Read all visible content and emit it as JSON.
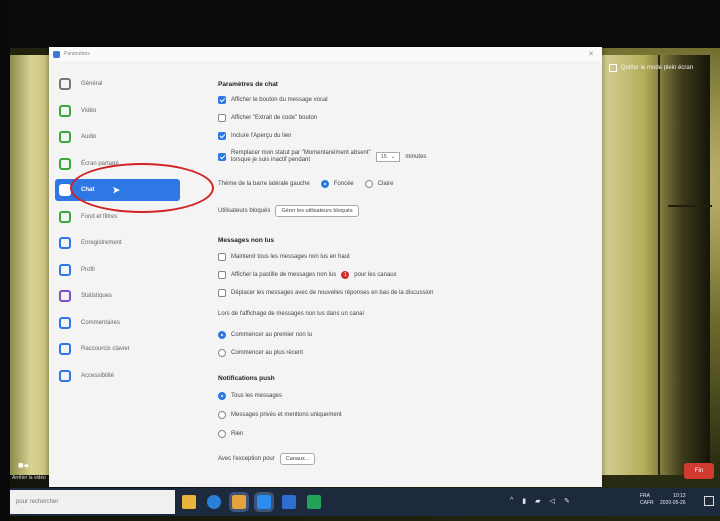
{
  "window": {
    "title": "Paramètres"
  },
  "fullscreen_exit": "Quitter le mode plein écran",
  "video_label": "Arrêter la vidéo",
  "end_button": "Fin",
  "sidebar": {
    "items": [
      {
        "label": "Général",
        "color": "#777777"
      },
      {
        "label": "Vidéo",
        "color": "#3aa83a"
      },
      {
        "label": "Audio",
        "color": "#3aa83a"
      },
      {
        "label": "Écran partagé",
        "color": "#3aa83a"
      },
      {
        "label": "Chat",
        "color": "#2d78e4",
        "active": true
      },
      {
        "label": "Fond et filtres",
        "color": "#3aa83a"
      },
      {
        "label": "Enregistrement",
        "color": "#2d78e4"
      },
      {
        "label": "Profil",
        "color": "#2d78e4"
      },
      {
        "label": "Statistiques",
        "color": "#7b4fc9"
      },
      {
        "label": "Commentaires",
        "color": "#2d78e4"
      },
      {
        "label": "Raccourcis clavier",
        "color": "#2d78e4"
      },
      {
        "label": "Accessibilité",
        "color": "#2d78e4"
      }
    ]
  },
  "chat_settings": {
    "title": "Paramètres de chat",
    "options": [
      {
        "label": "Afficher le bouton du message vocal",
        "checked": true
      },
      {
        "label": "Afficher \"Extrait de code\" bouton",
        "checked": false
      },
      {
        "label": "Inclure l'Aperçu du lien",
        "checked": true
      }
    ],
    "away": {
      "line1": "Remplacer mon statut par \"Momentanément absent\"",
      "line2": "lorsque je suis inactif pendant",
      "minutes_value": "15",
      "minutes_label": "minutes",
      "checked": true
    },
    "theme": {
      "label": "Thème de la barre latérale gauche",
      "option_dark": "Foncée",
      "option_light": "Claire",
      "selected": "Foncée"
    },
    "blocked": {
      "label": "Utilisateurs bloqués",
      "button": "Gérer les utilisateurs bloqués"
    }
  },
  "unread": {
    "title": "Messages non lus",
    "options": [
      {
        "label": "Maintenir tous les messages non lus en haut",
        "checked": false
      },
      {
        "label_pre": "Afficher la pastille de messages non lus",
        "label_post": "pour les canaux",
        "checked": false,
        "badge": "1"
      },
      {
        "label": "Déplacer les messages avec de nouvelles réponses en bas de la discussion",
        "checked": false
      }
    ],
    "display_title": "Lors de l'affichage de messages non lus dans un canal",
    "display_options": [
      {
        "label": "Commencer au premier non lu",
        "checked": true
      },
      {
        "label": "Commencer au plus récent",
        "checked": false
      }
    ]
  },
  "push": {
    "title": "Notifications push",
    "options": [
      {
        "label": "Tous les messages",
        "checked": true
      },
      {
        "label": "Messages privés et mentions uniquement",
        "checked": false
      },
      {
        "label": "Rien",
        "checked": false
      }
    ],
    "exception_label": "Avec l'exception pour",
    "exception_button": "Canaux..."
  },
  "taskbar": {
    "search_placeholder": "pour rechercher",
    "lang": [
      "FRA",
      "CAFR"
    ],
    "time": "10:13",
    "date": "2020-05-26"
  }
}
